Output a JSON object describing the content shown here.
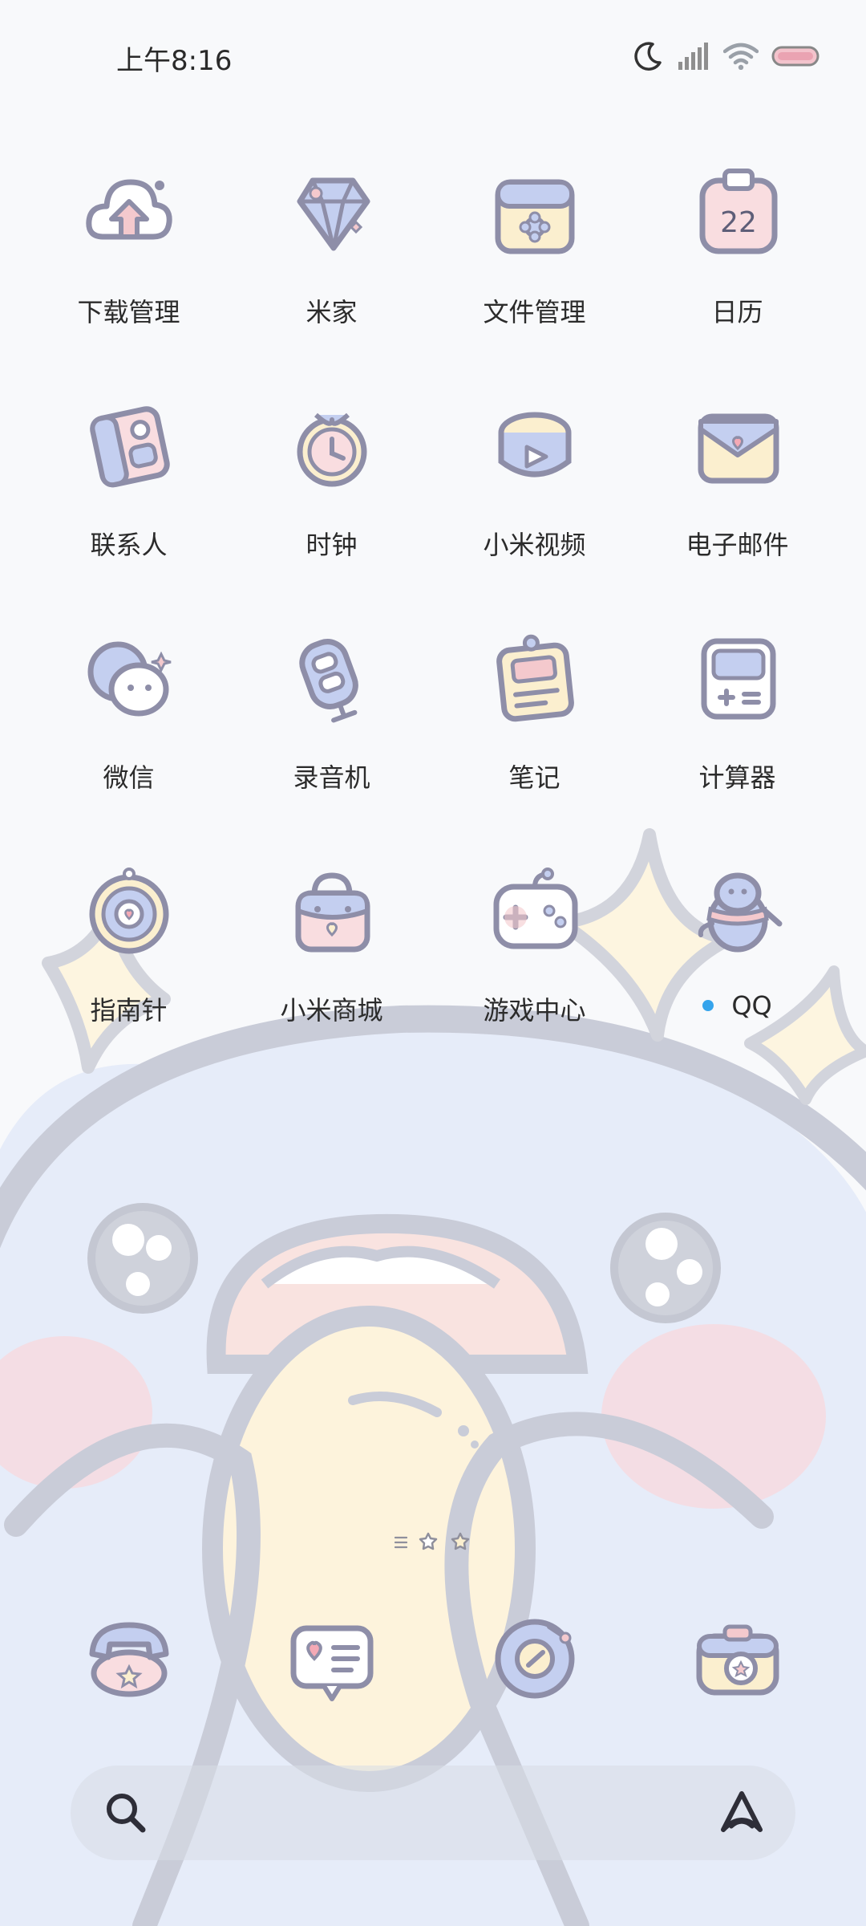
{
  "status_bar": {
    "time": "上午8:16",
    "icons": [
      "moon-icon",
      "signal-icon",
      "wifi-icon",
      "battery-icon"
    ]
  },
  "apps": [
    {
      "label": "下载管理",
      "icon": "download-cloud-icon"
    },
    {
      "label": "米家",
      "icon": "mijia-icon"
    },
    {
      "label": "文件管理",
      "icon": "file-manager-icon"
    },
    {
      "label": "日历",
      "icon": "calendar-icon",
      "badge": "22"
    },
    {
      "label": "联系人",
      "icon": "contacts-icon"
    },
    {
      "label": "时钟",
      "icon": "clock-icon"
    },
    {
      "label": "小米视频",
      "icon": "video-icon"
    },
    {
      "label": "电子邮件",
      "icon": "email-icon"
    },
    {
      "label": "微信",
      "icon": "wechat-icon"
    },
    {
      "label": "录音机",
      "icon": "recorder-icon"
    },
    {
      "label": "笔记",
      "icon": "notes-icon"
    },
    {
      "label": "计算器",
      "icon": "calculator-icon"
    },
    {
      "label": "指南针",
      "icon": "compass-icon"
    },
    {
      "label": "小米商城",
      "icon": "mi-store-icon"
    },
    {
      "label": "游戏中心",
      "icon": "game-center-icon"
    },
    {
      "label": "QQ",
      "icon": "qq-penguin-icon",
      "has_notification": true
    }
  ],
  "dock": [
    {
      "icon": "phone-icon"
    },
    {
      "icon": "messages-icon"
    },
    {
      "icon": "browser-icon"
    },
    {
      "icon": "camera-icon"
    }
  ],
  "search_bar": {
    "left_icon": "search-icon",
    "right_icon": "assistant-icon"
  },
  "colors": {
    "outline": "#8e8ea8",
    "lavender": "#c4cff0",
    "pink": "#f4c9cd",
    "cream": "#fbefcf",
    "notification_dot": "#35a4ec"
  }
}
